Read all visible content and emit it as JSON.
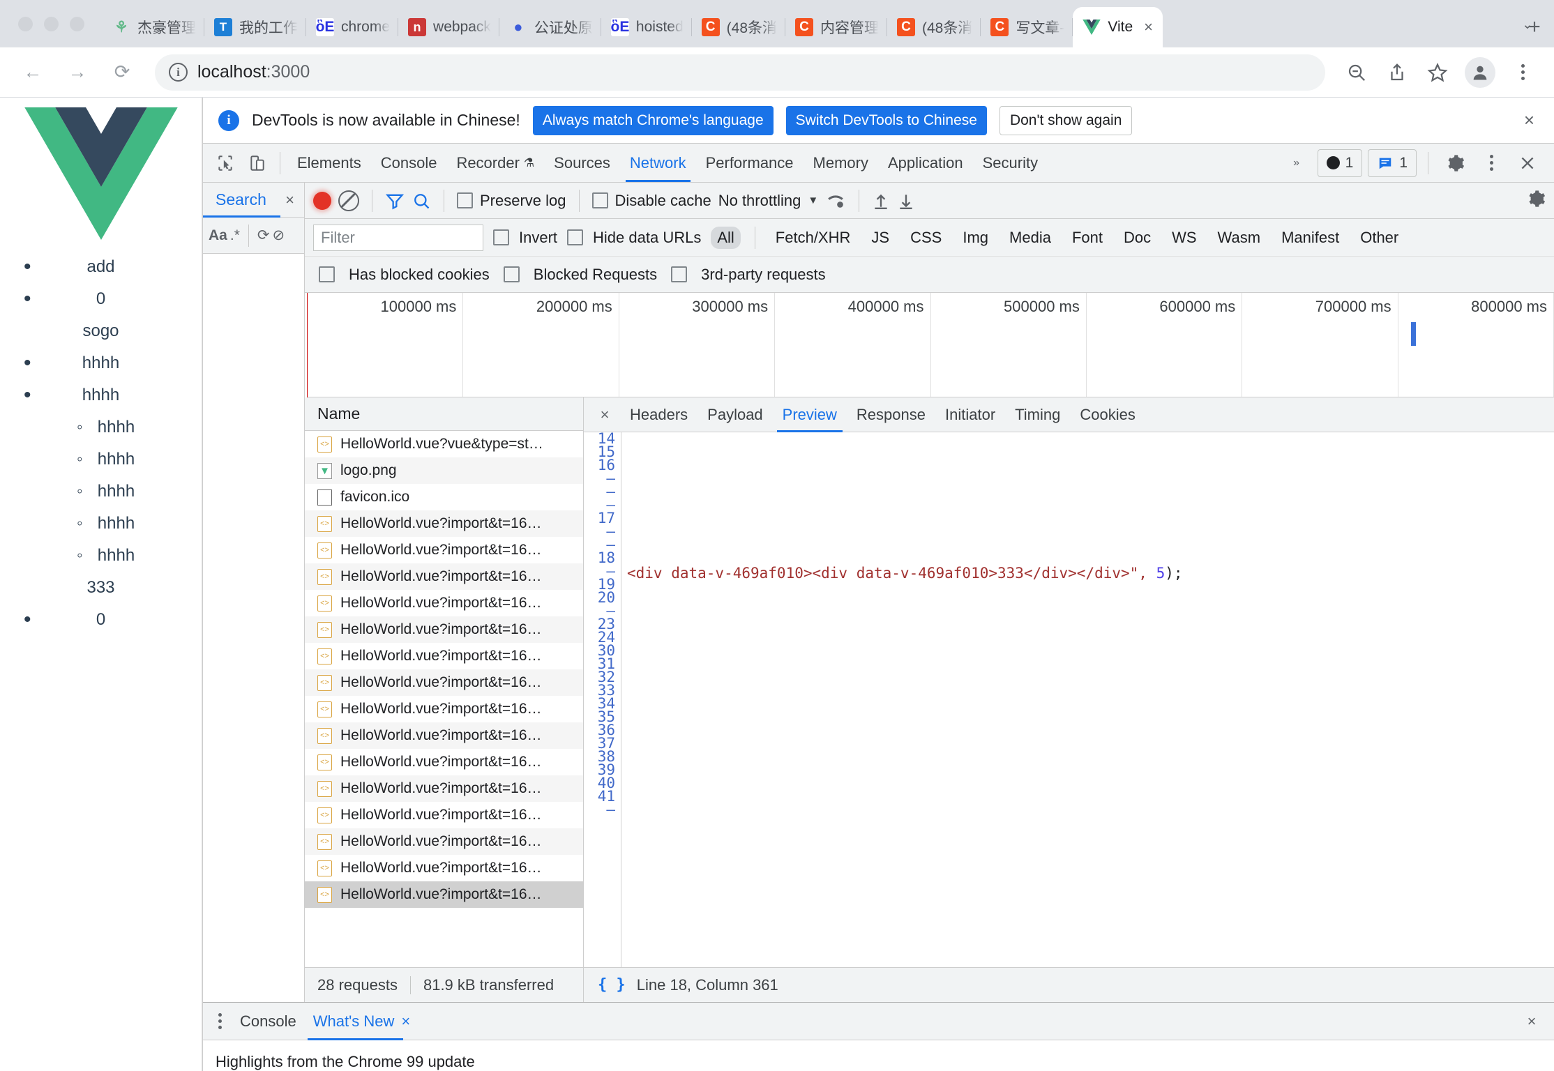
{
  "browser": {
    "tabs": [
      {
        "title": "杰豪管理",
        "icon": "grass-icon",
        "fav": "fav-grass",
        "glyph": "⚘"
      },
      {
        "title": "我的工作",
        "icon": "blue-doc-icon",
        "fav": "fav-blue",
        "glyph": "T"
      },
      {
        "title": "chrome",
        "icon": "baidu-icon",
        "fav": "fav-baidu",
        "glyph": "ὃE"
      },
      {
        "title": "webpack",
        "icon": "npm-icon",
        "fav": "fav-npm",
        "glyph": "n"
      },
      {
        "title": "公证处原",
        "icon": "owl-icon",
        "fav": "fav-owl",
        "glyph": "●"
      },
      {
        "title": "hoisted",
        "icon": "baidu-icon",
        "fav": "fav-baidu",
        "glyph": "ὃE"
      },
      {
        "title": "(48条消",
        "icon": "csdn-icon",
        "fav": "fav-c",
        "glyph": "C"
      },
      {
        "title": "内容管理",
        "icon": "csdn-icon",
        "fav": "fav-c",
        "glyph": "C"
      },
      {
        "title": "(48条消",
        "icon": "csdn-icon",
        "fav": "fav-c",
        "glyph": "C"
      },
      {
        "title": "写文章-",
        "icon": "csdn-icon",
        "fav": "fav-c",
        "glyph": "C"
      }
    ],
    "active_tab": {
      "title": "Vite",
      "icon": "vue-icon"
    },
    "new_tab_label": "+",
    "tab_list_label": "⌄",
    "url": "localhost",
    "url_suffix": ":3000",
    "nav": {
      "back": "←",
      "forward": "→",
      "reload": "⟳"
    },
    "info_icon": "i"
  },
  "page": {
    "logo": "vue-logo",
    "items": [
      {
        "text": "add",
        "bullet": "disc",
        "indent": false
      },
      {
        "text": "0",
        "bullet": "disc",
        "indent": false
      },
      {
        "text": "sogo",
        "bullet": "none",
        "indent": false
      },
      {
        "text": "hhhh",
        "bullet": "disc",
        "indent": false
      },
      {
        "text": "hhhh",
        "bullet": "disc",
        "indent": false
      },
      {
        "text": "hhhh",
        "bullet": "both",
        "indent": true
      },
      {
        "text": "hhhh",
        "bullet": "circle",
        "indent": true
      },
      {
        "text": "hhhh",
        "bullet": "circle",
        "indent": true
      },
      {
        "text": "hhhh",
        "bullet": "circle",
        "indent": true
      },
      {
        "text": "hhhh",
        "bullet": "circle",
        "indent": true
      },
      {
        "text": "333",
        "bullet": "none",
        "indent": false
      },
      {
        "text": "0",
        "bullet": "disc",
        "indent": false
      }
    ]
  },
  "banner": {
    "message": "DevTools is now available in Chinese!",
    "primary_1": "Always match Chrome's language",
    "primary_2": "Switch DevTools to Chinese",
    "ghost": "Don't show again",
    "close": "×"
  },
  "devtools": {
    "tabs": [
      "Elements",
      "Console",
      "Recorder",
      "Sources",
      "Network",
      "Performance",
      "Memory",
      "Application",
      "Security"
    ],
    "active_tab": "Network",
    "overflow": "»",
    "error_count": "1",
    "message_count": "1",
    "settings_icon": "gear-icon",
    "more_icon": "kebab-icon",
    "close_icon": "close-icon"
  },
  "search_panel": {
    "title": "Search",
    "close": "×",
    "match_case": "Aa",
    "regex": ".*",
    "refresh": "⟳",
    "clear": "⊘"
  },
  "network_toolbar": {
    "record": "record-button",
    "clear": "clear-button",
    "filter_icon": "funnel-icon",
    "search_icon": "search-icon",
    "preserve_log": "Preserve log",
    "disable_cache": "Disable cache",
    "throttling": "No throttling",
    "caret": "▼",
    "wifi_icon": "wifi-settings-icon",
    "import_icon": "upload-icon",
    "export_icon": "download-icon",
    "gear": "gear-icon"
  },
  "network_filter": {
    "placeholder": "Filter",
    "invert": "Invert",
    "hide_data_urls": "Hide data URLs",
    "types": [
      "All",
      "Fetch/XHR",
      "JS",
      "CSS",
      "Img",
      "Media",
      "Font",
      "Doc",
      "WS",
      "Wasm",
      "Manifest",
      "Other"
    ],
    "active_type": "All",
    "has_blocked_cookies": "Has blocked cookies",
    "blocked_requests": "Blocked Requests",
    "third_party": "3rd-party requests"
  },
  "overview": {
    "ticks": [
      "100000 ms",
      "200000 ms",
      "300000 ms",
      "400000 ms",
      "500000 ms",
      "600000 ms",
      "700000 ms",
      "800000 ms"
    ]
  },
  "request_list": {
    "header": "Name",
    "rows": [
      {
        "name": "HelloWorld.vue?vue&type=st…",
        "icon": "code-file-icon",
        "selected": false
      },
      {
        "name": "logo.png",
        "icon": "image-file-icon",
        "selected": false
      },
      {
        "name": "favicon.ico",
        "icon": "plain-file-icon",
        "selected": false
      },
      {
        "name": "HelloWorld.vue?import&t=16…",
        "icon": "code-file-icon",
        "selected": false
      },
      {
        "name": "HelloWorld.vue?import&t=16…",
        "icon": "code-file-icon",
        "selected": false
      },
      {
        "name": "HelloWorld.vue?import&t=16…",
        "icon": "code-file-icon",
        "selected": false
      },
      {
        "name": "HelloWorld.vue?import&t=16…",
        "icon": "code-file-icon",
        "selected": false
      },
      {
        "name": "HelloWorld.vue?import&t=16…",
        "icon": "code-file-icon",
        "selected": false
      },
      {
        "name": "HelloWorld.vue?import&t=16…",
        "icon": "code-file-icon",
        "selected": false
      },
      {
        "name": "HelloWorld.vue?import&t=16…",
        "icon": "code-file-icon",
        "selected": false
      },
      {
        "name": "HelloWorld.vue?import&t=16…",
        "icon": "code-file-icon",
        "selected": false
      },
      {
        "name": "HelloWorld.vue?import&t=16…",
        "icon": "code-file-icon",
        "selected": false
      },
      {
        "name": "HelloWorld.vue?import&t=16…",
        "icon": "code-file-icon",
        "selected": false
      },
      {
        "name": "HelloWorld.vue?import&t=16…",
        "icon": "code-file-icon",
        "selected": false
      },
      {
        "name": "HelloWorld.vue?import&t=16…",
        "icon": "code-file-icon",
        "selected": false
      },
      {
        "name": "HelloWorld.vue?import&t=16…",
        "icon": "code-file-icon",
        "selected": false
      },
      {
        "name": "HelloWorld.vue?import&t=16…",
        "icon": "code-file-icon",
        "selected": false
      },
      {
        "name": "HelloWorld.vue?import&t=16…",
        "icon": "code-file-icon",
        "selected": true
      }
    ]
  },
  "detail": {
    "close": "×",
    "tabs": [
      "Headers",
      "Payload",
      "Preview",
      "Response",
      "Initiator",
      "Timing",
      "Cookies"
    ],
    "active_tab": "Preview",
    "gutter": [
      "14",
      "15",
      "16",
      "–",
      "–",
      "–",
      "17",
      "–",
      "–",
      "18",
      "–",
      "19",
      "20",
      "–",
      "23",
      "24",
      "30",
      "31",
      "32",
      "33",
      "34",
      "35",
      "36",
      "37",
      "38",
      "39",
      "40",
      "41",
      "–"
    ],
    "code_line": "<div data-v-469af010><div data-v-469af010>333</div></div>\", ",
    "code_num": "5",
    "code_tail": ");"
  },
  "status_bar": {
    "requests": "28 requests",
    "transferred": "81.9 kB transferred",
    "braces": "{ }",
    "position": "Line 18, Column 361"
  },
  "drawer": {
    "tabs": [
      "Console",
      "What's New"
    ],
    "active_tab": "What's New",
    "tab_close": "×",
    "close": "×",
    "body_text": "Highlights from the Chrome 99 update"
  }
}
